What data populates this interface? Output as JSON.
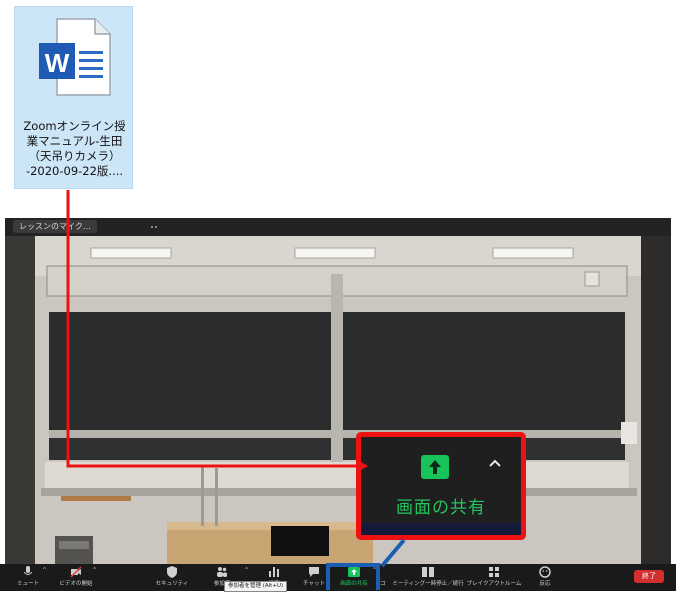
{
  "desktop_file": {
    "name": "Zoomオンライン授\n業マニュアル-生田\n（天吊りカメラ）\n-2020-09-22版....",
    "icon": "word-document-icon",
    "app_letter": "W"
  },
  "zoom_window": {
    "title": "レッスンのマイク…"
  },
  "callout": {
    "label": "画面の共有",
    "accent": "#22c55e",
    "border": "#ee1111"
  },
  "toolbar": {
    "items": [
      {
        "label": "ミュート",
        "icon": "microphone-icon"
      },
      {
        "label": "ビデオの開始",
        "icon": "video-off-icon"
      },
      {
        "label": "セキュリティ",
        "icon": "shield-icon"
      },
      {
        "label": "参加者",
        "icon": "participants-icon"
      },
      {
        "label": "投票",
        "icon": "poll-icon"
      },
      {
        "label": "チャット",
        "icon": "chat-icon"
      },
      {
        "label": "画面の共有",
        "icon": "share-screen-icon"
      },
      {
        "label": "レコーディング",
        "icon": "record-icon"
      },
      {
        "label": "ミーティング一時停止／続行",
        "icon": "pause-icon"
      },
      {
        "label": "ブレイクアウトルーム",
        "icon": "breakout-rooms-icon"
      },
      {
        "label": "反応",
        "icon": "reactions-icon"
      }
    ],
    "end_label": "終了",
    "tooltip": "参加者を管理 (Alt+U)",
    "share_color": "#17c35a",
    "end_color": "#d32f2f",
    "highlight_color": "#1a5fb4"
  }
}
